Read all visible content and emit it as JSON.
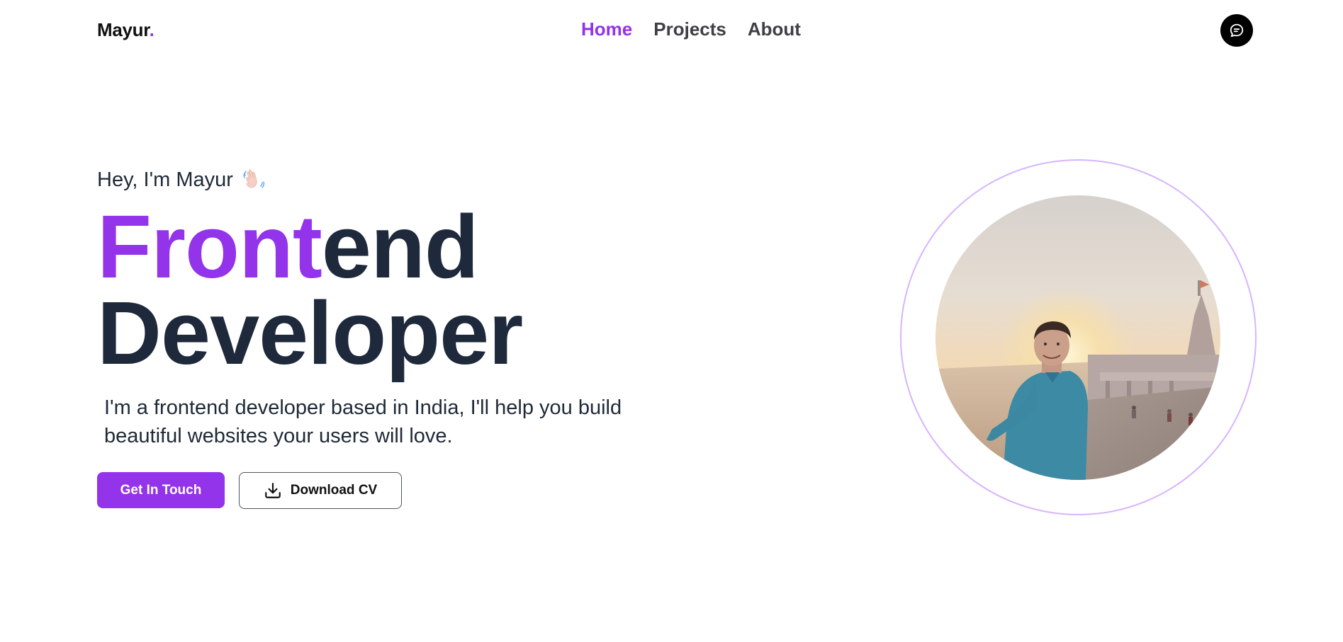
{
  "nav": {
    "logo_text": "Mayur",
    "logo_dot": ".",
    "links": [
      {
        "label": "Home",
        "active": true
      },
      {
        "label": "Projects",
        "active": false
      },
      {
        "label": "About",
        "active": false
      }
    ],
    "chat_icon": "chat-bubble-icon"
  },
  "hero": {
    "greeting": "Hey, I'm Mayur",
    "greeting_icon": "waving-hand-icon",
    "headline_accent": "Front",
    "headline_rest": "end",
    "headline_line2": "Developer",
    "description": "I'm a frontend developer based in India, I'll help you build beautiful websites your users will love.",
    "primary_button": "Get In Touch",
    "secondary_button": "Download CV",
    "secondary_icon": "download-icon",
    "photo": "profile-photo"
  },
  "colors": {
    "accent": "#9333ea",
    "heading": "#1e293b",
    "ring": "#d8b4fe",
    "chat_button": "#000000"
  }
}
